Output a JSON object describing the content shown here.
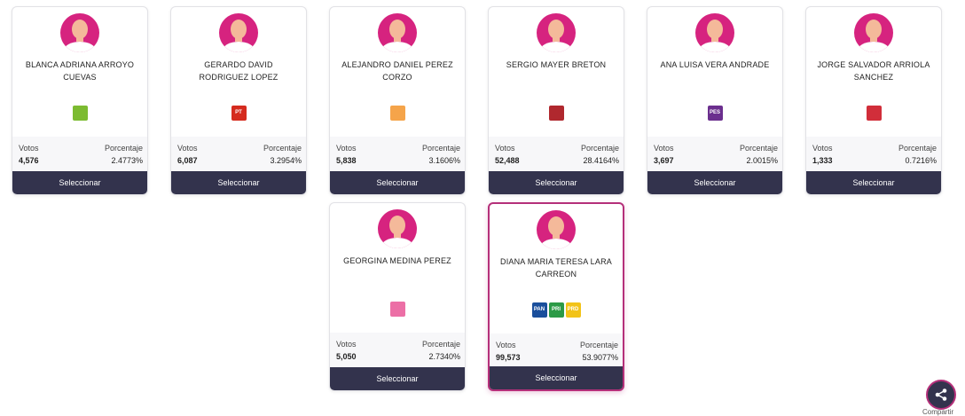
{
  "labels": {
    "votes": "Votos",
    "percentage": "Porcentaje",
    "select": "Seleccionar",
    "share": "Compartir"
  },
  "candidates": [
    {
      "name": "BLANCA ADRIANA ARROYO CUEVAS",
      "votes": "4,576",
      "percentage": "2.4773%",
      "parties": [
        {
          "icon": "pvem-logo",
          "color": "#7cbb31",
          "text": ""
        }
      ],
      "selected": false
    },
    {
      "name": "GERARDO DAVID RODRIGUEZ LOPEZ",
      "votes": "6,087",
      "percentage": "3.2954%",
      "parties": [
        {
          "icon": "pt-logo",
          "color": "#d52b1e",
          "text": "PT"
        }
      ],
      "selected": false
    },
    {
      "name": "ALEJANDRO DANIEL PEREZ CORZO",
      "votes": "5,838",
      "percentage": "3.1606%",
      "parties": [
        {
          "icon": "mc-logo",
          "color": "#f5a44a",
          "text": ""
        }
      ],
      "selected": false
    },
    {
      "name": "SERGIO MAYER BRETON",
      "votes": "52,488",
      "percentage": "28.4164%",
      "parties": [
        {
          "icon": "morena-logo",
          "color": "#b0282e",
          "text": ""
        }
      ],
      "selected": false
    },
    {
      "name": "ANA LUISA VERA ANDRADE",
      "votes": "3,697",
      "percentage": "2.0015%",
      "parties": [
        {
          "icon": "pes-logo",
          "color": "#6b2f8e",
          "text": "PES"
        }
      ],
      "selected": false
    },
    {
      "name": "JORGE SALVADOR ARRIOLA SANCHEZ",
      "votes": "1,333",
      "percentage": "0.7216%",
      "parties": [
        {
          "icon": "rsp-logo",
          "color": "#d12e3a",
          "text": ""
        }
      ],
      "selected": false
    },
    {
      "name": "GEORGINA MEDINA PEREZ",
      "votes": "5,050",
      "percentage": "2.7340%",
      "parties": [
        {
          "icon": "fxm-logo",
          "color": "#ec6fa6",
          "text": ""
        }
      ],
      "selected": false
    },
    {
      "name": "DIANA MARIA TERESA LARA CARREON",
      "votes": "99,573",
      "percentage": "53.9077%",
      "parties": [
        {
          "icon": "pan-logo",
          "color": "#1a4f9c",
          "text": "PAN"
        },
        {
          "icon": "pri-logo",
          "color": "#2c9a46",
          "text": "PRI"
        },
        {
          "icon": "prd-logo",
          "color": "#f2c318",
          "text": "PRD"
        }
      ],
      "selected": true
    }
  ]
}
